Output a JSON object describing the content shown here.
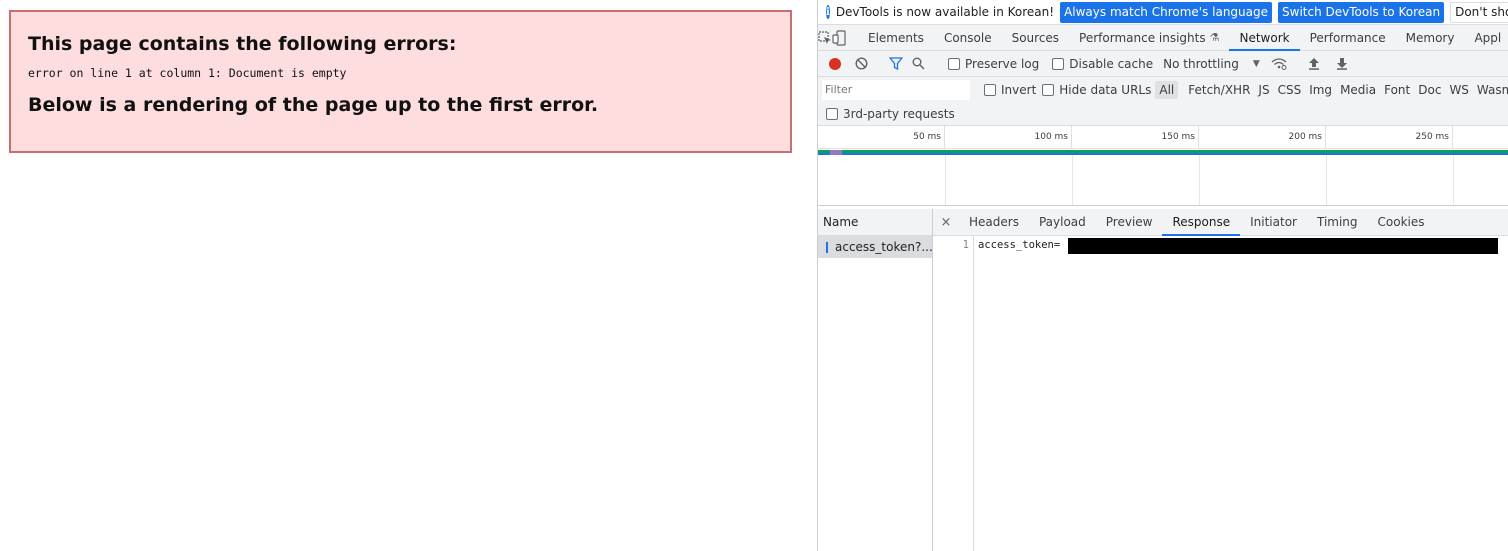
{
  "error_page": {
    "heading": "This page contains the following errors:",
    "message": "error on line 1 at column 1: Document is empty",
    "footer": "Below is a rendering of the page up to the first error."
  },
  "devtools": {
    "infobar": {
      "text": "DevTools is now available in Korean!",
      "btn_match": "Always match Chrome's language",
      "btn_switch": "Switch DevTools to Korean",
      "btn_dismiss": "Don't show again"
    },
    "tabs": [
      "Elements",
      "Console",
      "Sources",
      "Performance insights",
      "Network",
      "Performance",
      "Memory",
      "Appl"
    ],
    "active_tab": "Network",
    "toolbar": {
      "preserve_log": "Preserve log",
      "disable_cache": "Disable cache",
      "throttling": "No throttling"
    },
    "filter": {
      "placeholder": "Filter",
      "invert": "Invert",
      "hide_data_urls": "Hide data URLs",
      "types": [
        "All",
        "Fetch/XHR",
        "JS",
        "CSS",
        "Img",
        "Media",
        "Font",
        "Doc",
        "WS",
        "Wasm"
      ],
      "active_type": "All",
      "third_party": "3rd-party requests"
    },
    "timeline": {
      "ticks": [
        "50 ms",
        "100 ms",
        "150 ms",
        "200 ms",
        "250 ms"
      ]
    },
    "requests": {
      "name_header": "Name",
      "items": [
        "access_token?..."
      ]
    },
    "detail": {
      "close": "×",
      "tabs": [
        "Headers",
        "Payload",
        "Preview",
        "Response",
        "Initiator",
        "Timing",
        "Cookies"
      ],
      "active_tab": "Response",
      "line_number": "1",
      "line_text": "access_token="
    },
    "colors": {
      "accent": "#1a73e8",
      "record": "#d93025",
      "error_bg": "#fddddd",
      "error_border": "#c76f6f"
    }
  }
}
